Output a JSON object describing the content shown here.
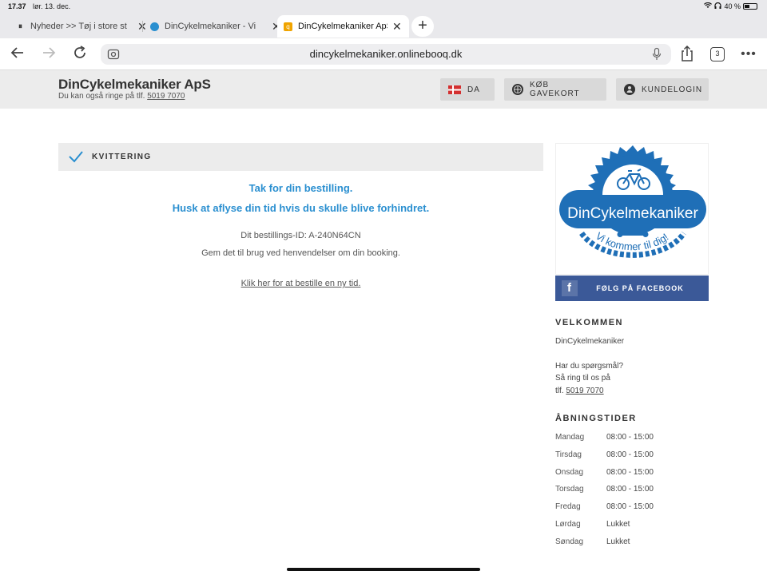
{
  "status": {
    "time": "17.37",
    "date": "lør. 13. dec.",
    "battery": "40 %"
  },
  "tabs": [
    {
      "title": "Nyheder >> Tøj i store st",
      "active": false
    },
    {
      "title": "DinCykelmekaniker - Vi",
      "active": false
    },
    {
      "title": "DinCykelmekaniker ApS",
      "active": true
    }
  ],
  "toolbar": {
    "url": "dincykelmekaniker.onlinebooq.dk",
    "tab_count": "3"
  },
  "header": {
    "brand": "DinCykelmekaniker ApS",
    "subtitle": "Du kan også ringe på tlf.",
    "phone": "5019 7070",
    "lang_label": "DA",
    "gift_label": "KØB GAVEKORT",
    "login_label": "KUNDELOGIN"
  },
  "receipt": {
    "heading": "KVITTERING",
    "thanks": "Tak for din bestilling.",
    "reminder": "Husk at aflyse din tid hvis du skulle blive forhindret.",
    "order_id_line": "Dit bestillings-ID: A-240N64CN",
    "save_note": "Gem det til brug ved henvendelser om din booking.",
    "new_booking_link": "Klik her for at bestille en ny tid."
  },
  "sidebar": {
    "logo_text": "DinCykelmekaniker",
    "logo_slogan": "Vi kommer til dig!",
    "facebook_label": "FØLG PÅ FACEBOOK",
    "welcome_heading": "VELKOMMEN",
    "welcome_name": "DinCykelmekaniker",
    "question": "Har du spørgsmål?",
    "call_line": "Så ring til os på",
    "tel_prefix": "tlf.",
    "phone": "5019 7070",
    "hours_heading": "ÅBNINGSTIDER",
    "hours": [
      {
        "day": "Mandag",
        "time": "08:00 - 15:00"
      },
      {
        "day": "Tirsdag",
        "time": "08:00 - 15:00"
      },
      {
        "day": "Onsdag",
        "time": "08:00 - 15:00"
      },
      {
        "day": "Torsdag",
        "time": "08:00 - 15:00"
      },
      {
        "day": "Fredag",
        "time": "08:00 - 15:00"
      },
      {
        "day": "Lørdag",
        "time": "Lukket"
      },
      {
        "day": "Søndag",
        "time": "Lukket"
      }
    ]
  },
  "colors": {
    "accent_blue": "#2a8fd0",
    "logo_blue": "#1f6fb7",
    "facebook": "#3b5998"
  }
}
